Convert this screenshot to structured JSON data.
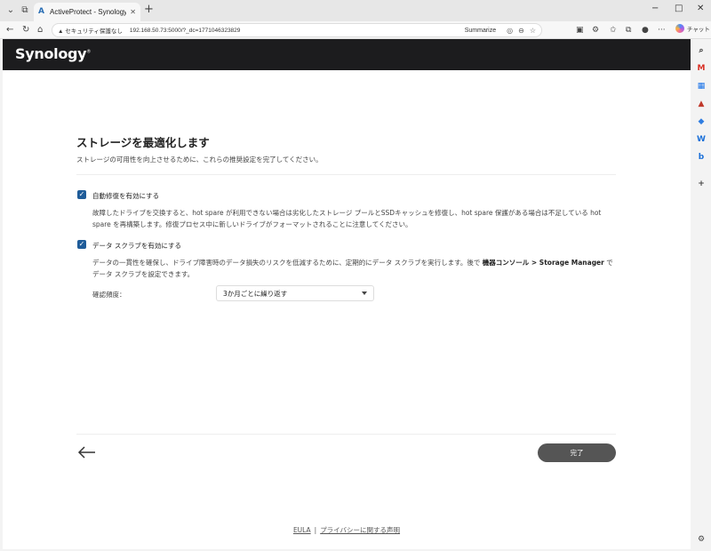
{
  "browser": {
    "tab_title": "ActiveProtect - Synology ActiveP",
    "security_warning": "セキュリティ保護なし",
    "url": "192.168.50.73:5000/?_dc=1771046323829",
    "summarize_label": "Summarize",
    "chat_label": "チャット",
    "icons": {
      "new_tab": "+",
      "minimize": "−",
      "maximize": "□",
      "close": "✕",
      "more": "···"
    }
  },
  "app": {
    "logo": "Synology"
  },
  "page": {
    "title": "ストレージを最適化します",
    "subtitle": "ストレージの可用性を向上させるために、これらの推奨設定を完了してください。",
    "auto_repair": {
      "checked": true,
      "label": "自動修復を有効にする",
      "description": "故障したドライブを交換すると、hot spare が利用できない場合は劣化したストレージ プールとSSDキャッシュを修復し、hot spare 保護がある場合は不足している hot spare を再構築します。修復プロセス中に新しいドライブがフォーマットされることに注意してください。"
    },
    "data_scrub": {
      "checked": true,
      "label": "データ スクラブを有効にする",
      "description_before": "データの一貫性を確保し、ドライブ障害時のデータ損失のリスクを低減するために、定期的にデータ スクラブを実行します。後で ",
      "description_bold": "機器コンソール > Storage Manager",
      "description_after": " でデータ スクラブを設定できます。",
      "frequency_label": "確認頻度：",
      "frequency_value": "3か月ごとに繰り返す"
    },
    "done_button": "完了"
  },
  "footer": {
    "eula": "EULA",
    "separator": "|",
    "privacy": "プライバシーに関する声明"
  },
  "colors": {
    "header_bg": "#1c1c1e",
    "checkbox": "#1f5c99",
    "done_button": "#555555"
  }
}
